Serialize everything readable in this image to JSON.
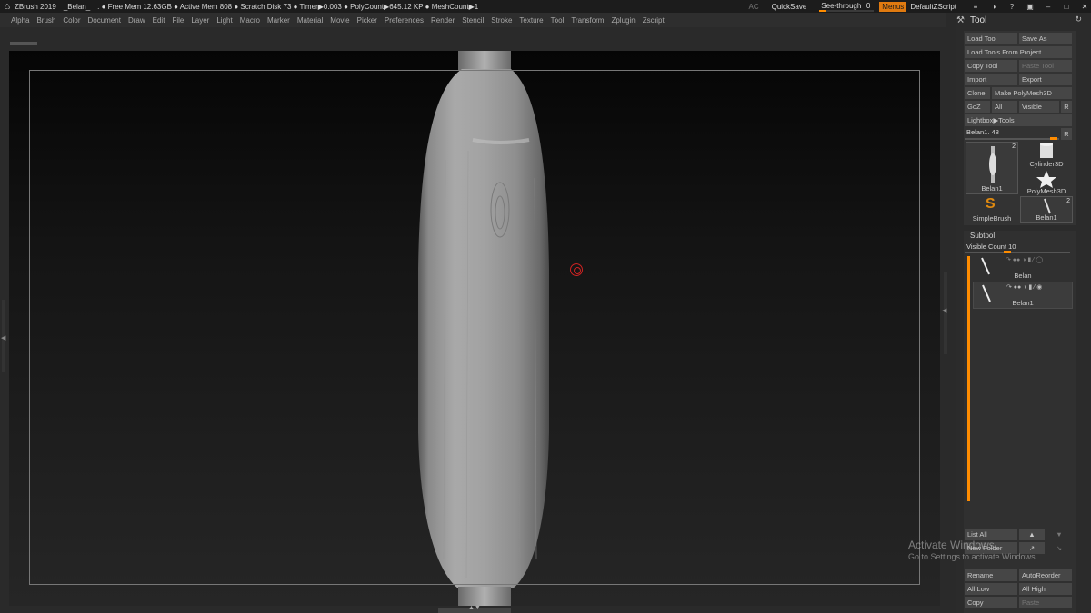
{
  "titlebar": {
    "app": "ZBrush 2019",
    "doc": "_Belan_",
    "stats": ". ● Free Mem 12.63GB ● Active Mem 808 ● Scratch Disk 73 ● Timer▶0.003 ● PolyCount▶645.12 KP ● MeshCount▶1",
    "ac": "AC",
    "quicksave": "QuickSave",
    "seethrough_label": "See-through",
    "seethrough_value": "0",
    "menus": "Menus",
    "script": "DefaultZScript"
  },
  "menubar": [
    "Alpha",
    "Brush",
    "Color",
    "Document",
    "Draw",
    "Edit",
    "File",
    "Layer",
    "Light",
    "Macro",
    "Marker",
    "Material",
    "Movie",
    "Picker",
    "Preferences",
    "Render",
    "Stencil",
    "Stroke",
    "Texture",
    "Tool",
    "Transform",
    "Zplugin",
    "Zscript"
  ],
  "tool": {
    "title": "Tool",
    "load_tool": "Load Tool",
    "save_as": "Save As",
    "load_from_project": "Load Tools From Project",
    "copy_tool": "Copy Tool",
    "paste_tool": "Paste Tool",
    "import": "Import",
    "export": "Export",
    "clone": "Clone",
    "make_polymesh": "Make PolyMesh3D",
    "goz": "GoZ",
    "all": "All",
    "visible": "Visible",
    "r": "R",
    "lightbox": "Lightbox▶Tools",
    "current": "Belan1. 48",
    "current_r": "R",
    "thumbs": [
      {
        "label": "Belan1",
        "count": "2"
      },
      {
        "label": "Cylinder3D",
        "count": ""
      },
      {
        "label": "PolyMesh3D",
        "count": ""
      },
      {
        "label": "SimpleBrush",
        "count": ""
      },
      {
        "label": "Belan1",
        "count": "2"
      }
    ]
  },
  "subtool": {
    "title": "Subtool",
    "visible_count": "Visible Count 10",
    "items": [
      "Belan",
      "Belan1"
    ],
    "list_all": "List All",
    "new_folder": "New Folder",
    "rename": "Rename",
    "autoreorder": "AutoReorder",
    "all_low": "All Low",
    "all_high": "All High",
    "copy": "Copy",
    "paste": "Paste"
  },
  "watermark": {
    "line1": "Activate Windows",
    "line2": "Go to Settings to activate Windows."
  },
  "colors": {
    "accent": "#ff8c00",
    "menus_bg": "#e07a10"
  }
}
